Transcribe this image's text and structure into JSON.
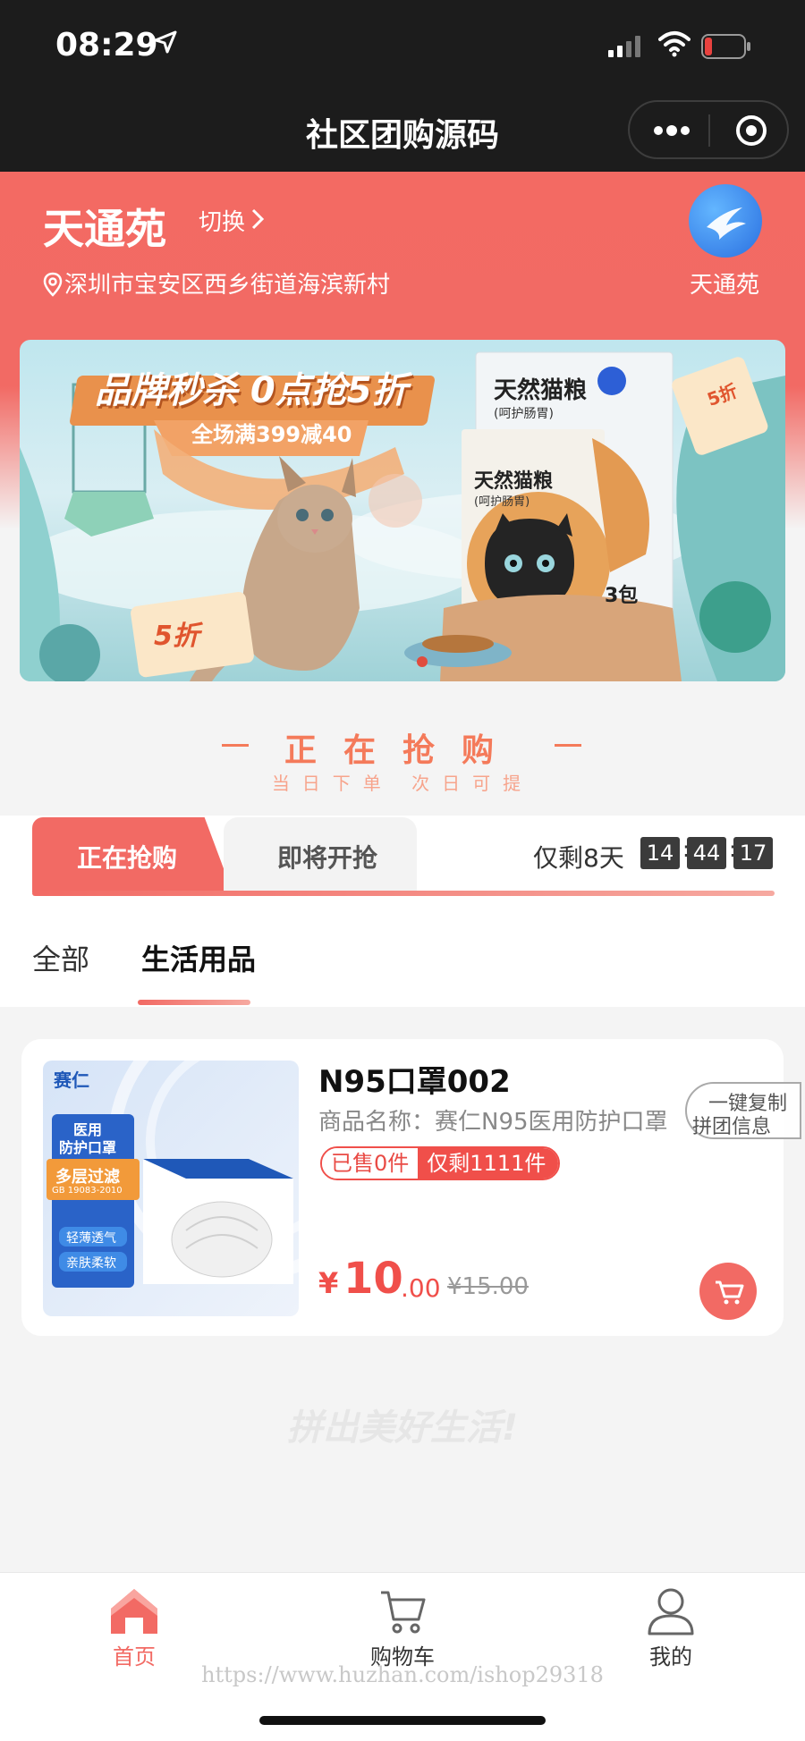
{
  "status_bar": {
    "time": "08:29"
  },
  "nav": {
    "title": "社区团购源码",
    "more_icon": "more-dots-icon",
    "close_icon": "target-icon"
  },
  "header": {
    "store_name": "天通苑",
    "switch_label": "切换",
    "address": "深圳市宝安区西乡街道海滨新村",
    "avatar_label": "天通苑"
  },
  "banner": {
    "headline": "品牌秒杀 0点抢5折",
    "subline": "全场满399减40",
    "box_title": "天然猫粮",
    "box_subtitle": "(呵护肠胃)",
    "bag_title": "天然猫粮",
    "bag_subtitle": "(呵护肠胃)",
    "pack_count": "3包",
    "badge_text": "5折",
    "corner_badge": "5折"
  },
  "slogan": {
    "main": "正在抢购",
    "sub": "当日下单 次日可提"
  },
  "tabs": {
    "active": "正在抢购",
    "upcoming": "即将开抢",
    "countdown_label": "仅剩8天",
    "countdown": [
      "14",
      "44",
      "17"
    ]
  },
  "categories": {
    "all": "全部",
    "active": "生活用品"
  },
  "product": {
    "title": "N95口罩002",
    "description": "商品名称：赛仁N95医用防护口罩",
    "copy_button": [
      "一键复制",
      "拼团信息"
    ],
    "sold": "已售0件",
    "remaining": "仅剩1111件",
    "price_symbol": "¥",
    "price_int": "10",
    "price_dec": ".00",
    "price_old": "¥15.00",
    "image_texts": {
      "brand": "赛仁",
      "label1": "医用",
      "label2": "防护口罩",
      "label3": "多层过滤",
      "label4": "GB 19083-2010",
      "label5": "轻薄透气",
      "label6": "亲肤柔软"
    }
  },
  "footer_slogan": "拼出美好生活!",
  "tabbar": {
    "items": [
      {
        "label": "首页",
        "icon": "home-icon",
        "active": true
      },
      {
        "label": "购物车",
        "icon": "cart-icon",
        "active": false
      },
      {
        "label": "我的",
        "icon": "user-icon",
        "active": false
      }
    ],
    "watermark": "https://www.huzhan.com/ishop29318"
  },
  "colors": {
    "accent": "#f26a64",
    "dark_bar": "#1c1c1c",
    "price": "#f04f4a"
  }
}
